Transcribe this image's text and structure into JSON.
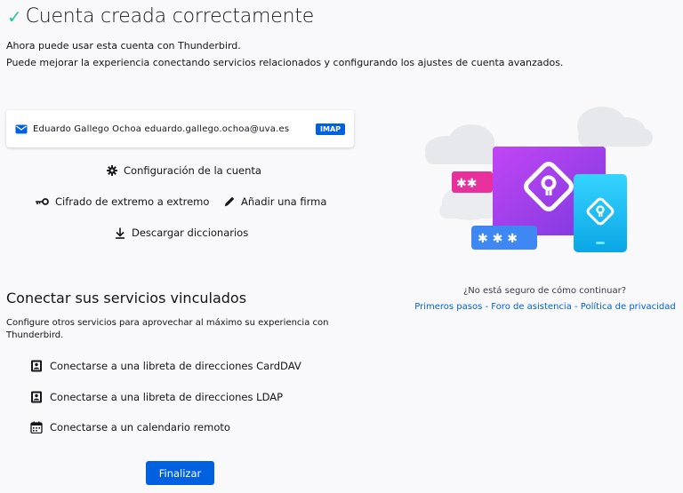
{
  "header": {
    "title": "Cuenta creada correctamente",
    "line1": "Ahora puede usar esta cuenta con Thunderbird.",
    "line2": "Puede mejorar la experiencia conectando servicios relacionados y configurando los ajustes de cuenta avanzados."
  },
  "account": {
    "email": "Eduardo Gallego Ochoa eduardo.gallego.ochoa@uva.es",
    "protocol": "IMAP"
  },
  "actions": {
    "account_settings": "Configuración de la cuenta",
    "e2e": "Cifrado de extremo a extremo",
    "signature": "Añadir una firma",
    "dictionaries": "Descargar diccionarios"
  },
  "linked": {
    "title": "Conectar sus servicios vinculados",
    "description": "Configure otros servicios para aprovechar al máximo su experiencia con Thunderbird.",
    "carddav": "Conectarse a una libreta de direcciones CardDAV",
    "ldap": "Conectarse a una libreta de direcciones LDAP",
    "calendar": "Conectarse a un calendario remoto"
  },
  "finish_label": "Finalizar",
  "help": {
    "question": "¿No está seguro de cómo continuar?",
    "links": [
      "Primeros pasos",
      "Foro de asistencia",
      "Política de privacidad"
    ],
    "separator": " - "
  },
  "colors": {
    "accent": "#0061e0",
    "success": "#2ac3a2",
    "illustration_purple": "#9b3fe6",
    "illustration_cyan": "#12b8ef",
    "illustration_pink": "#e0309b",
    "illustration_blue": "#3e80f0"
  }
}
